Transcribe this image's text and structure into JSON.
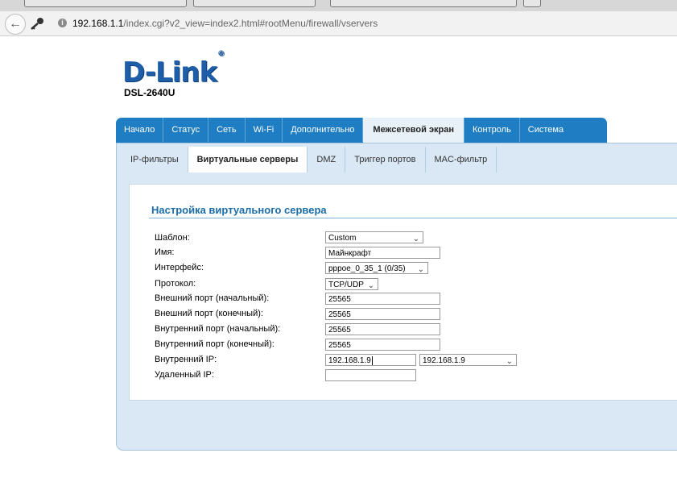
{
  "browser": {
    "url_host": "192.168.1.1",
    "url_path": "/index.cgi?v2_view=index2.html#rootMenu/firewall/vservers"
  },
  "brand": {
    "logo": "D-Link",
    "logo_mark": "®",
    "model": "DSL-2640U"
  },
  "main_tabs": [
    {
      "label": "Начало"
    },
    {
      "label": "Статус"
    },
    {
      "label": "Сеть"
    },
    {
      "label": "Wi-Fi"
    },
    {
      "label": "Дополнительно"
    },
    {
      "label": "Межсетевой экран"
    },
    {
      "label": "Контроль"
    },
    {
      "label": "Система"
    }
  ],
  "sub_tabs": [
    {
      "label": "IP-фильтры"
    },
    {
      "label": "Виртуальные серверы"
    },
    {
      "label": "DMZ"
    },
    {
      "label": "Триггер портов"
    },
    {
      "label": "MAC-фильтр"
    }
  ],
  "form": {
    "title": "Настройка виртуального сервера",
    "template_label": "Шаблон:",
    "template_value": "Custom",
    "name_label": "Имя:",
    "name_value": "Майнкрафт",
    "interface_label": "Интерфейс:",
    "interface_value": "pppoe_0_35_1 (0/35)",
    "protocol_label": "Протокол:",
    "protocol_value": "TCP/UDP",
    "ext_port_start_label": "Внешний порт (начальный):",
    "ext_port_start_value": "25565",
    "ext_port_end_label": "Внешний порт (конечный):",
    "ext_port_end_value": "25565",
    "int_port_start_label": "Внутренний порт (начальный):",
    "int_port_start_value": "25565",
    "int_port_end_label": "Внутренний порт (конечный):",
    "int_port_end_value": "25565",
    "internal_ip_label": "Внутренний IP:",
    "internal_ip_value": "192.168.1.9",
    "internal_ip_select_value": "192.168.1.9",
    "remote_ip_label": "Удаленный IP:",
    "remote_ip_value": ""
  }
}
